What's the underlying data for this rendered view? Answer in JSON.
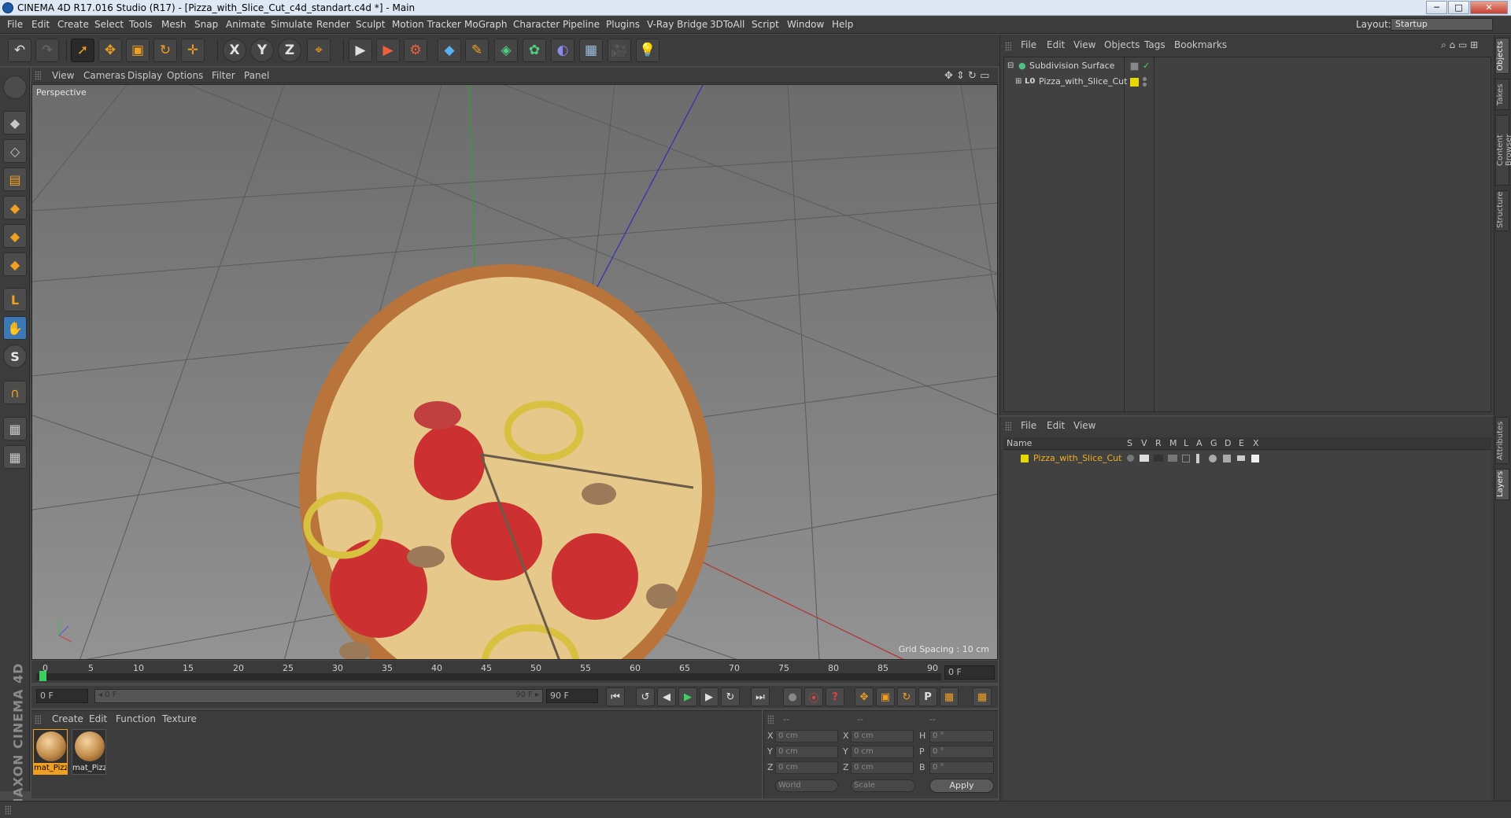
{
  "window": {
    "title": "CINEMA 4D R17.016 Studio (R17) - [Pizza_with_Slice_Cut_c4d_standart.c4d *] - Main",
    "minimize": "─",
    "maximize": "□",
    "close": "✕"
  },
  "menu": [
    "File",
    "Edit",
    "Create",
    "Select",
    "Tools",
    "Mesh",
    "Snap",
    "Animate",
    "Simulate",
    "Render",
    "Sculpt",
    "Motion Tracker",
    "MoGraph",
    "Character",
    "Pipeline",
    "Plugins",
    "V-Ray Bridge",
    "3DToAll",
    "Script",
    "Window",
    "Help"
  ],
  "layout": {
    "label": "Layout:",
    "value": "Startup"
  },
  "toolbar": {
    "undo_icon": "↶",
    "redo_icon": "↷",
    "select_icon": "➚",
    "move_icon": "✥",
    "scale_icon": "▣",
    "rotate_icon": "↻",
    "transform_icon": "✛",
    "x_label": "X",
    "y_label": "Y",
    "z_label": "Z",
    "coord_icon": "⌖",
    "render_view_icon": "▶",
    "render_pv_icon": "▶",
    "render_settings_icon": "⚙",
    "cube_icon": "◆",
    "pen_icon": "✎",
    "subdiv_icon": "◈",
    "cloner_icon": "✿",
    "deformer_icon": "◐",
    "floor_icon": "▦",
    "camera_icon": "🎥",
    "light_icon": "💡"
  },
  "left_tools": {
    "model_icon": "◆",
    "texture_icon": "◇",
    "workplane_icon": "▤",
    "points_icon": "◆",
    "edges_icon": "◆",
    "polys_icon": "◆",
    "axis_icon": "L",
    "tweak_icon": "✋",
    "snap_s_icon": "S",
    "magnet_icon": "∩",
    "grid_lock_icon": "▦",
    "grid_icon": "▦",
    "brand": "MAXON CINEMA 4D"
  },
  "viewport": {
    "menu": [
      "View",
      "Cameras",
      "Display",
      "Options",
      "Filter",
      "Panel"
    ],
    "camera_label": "Perspective",
    "grid_spacing": "Grid Spacing : 10 cm",
    "nav_icons": "✥ ⇕ ↻ ▭"
  },
  "timeline": {
    "ticks": [
      "0",
      "5",
      "10",
      "15",
      "20",
      "25",
      "30",
      "35",
      "40",
      "45",
      "50",
      "55",
      "60",
      "65",
      "70",
      "75",
      "80",
      "85",
      "90"
    ],
    "current_frame": "0 F",
    "start_field": "0 F",
    "range_start": "◂ 0 F",
    "range_end": "90 F ▸",
    "end_field": "90 F"
  },
  "playback": {
    "first": "⏮",
    "prev_key": "↺",
    "prev": "◀",
    "play": "▶",
    "next": "▶",
    "loop": "↻",
    "last": "⏭",
    "rec_key": "●",
    "auto_key": "⦿",
    "help": "?",
    "move_k": "✥",
    "scale_k": "▣",
    "rot_k": "↻",
    "param_k": "P",
    "pla_k": "▦",
    "film": "▦"
  },
  "material_manager": {
    "menu": [
      "Create",
      "Edit",
      "Function",
      "Texture"
    ],
    "materials": [
      "mat_Pizz",
      "mat_Pizz"
    ]
  },
  "coordinates": {
    "header": [
      "--",
      "--",
      "--"
    ],
    "rows": [
      {
        "a": "X",
        "av": "0 cm",
        "b": "X",
        "bv": "0 cm",
        "c": "H",
        "cv": "0 °"
      },
      {
        "a": "Y",
        "av": "0 cm",
        "b": "Y",
        "bv": "0 cm",
        "c": "P",
        "cv": "0 °"
      },
      {
        "a": "Z",
        "av": "0 cm",
        "b": "Z",
        "bv": "0 cm",
        "c": "B",
        "cv": "0 °"
      }
    ],
    "mode": "World",
    "scale": "Scale",
    "apply": "Apply"
  },
  "object_manager": {
    "menu": [
      "File",
      "Edit",
      "View",
      "Objects",
      "Tags",
      "Bookmarks"
    ],
    "objects": [
      {
        "name": "Subdivision Surface",
        "expander": "⊟",
        "icon": "●"
      },
      {
        "name": "Pizza_with_Slice_Cut",
        "expander": "⊞",
        "icon": "L0"
      }
    ],
    "check": "✓",
    "toolbar_icons": "⌕ ⌂ ▭ ⊞"
  },
  "layer_manager": {
    "menu": [
      "File",
      "Edit",
      "View"
    ],
    "columns": [
      "Name",
      "S",
      "V",
      "R",
      "M",
      "L",
      "A",
      "G",
      "D",
      "E",
      "X"
    ],
    "layers": [
      {
        "name": "Pizza_with_Slice_Cut"
      }
    ]
  },
  "right_tabs": [
    "Objects",
    "Takes",
    "Content Browser",
    "Structure",
    "Attributes",
    "Layers"
  ],
  "colors": {
    "accent": "#f0a020",
    "layer_yellow": "#e8d800",
    "selected_text": "#f0b020"
  }
}
